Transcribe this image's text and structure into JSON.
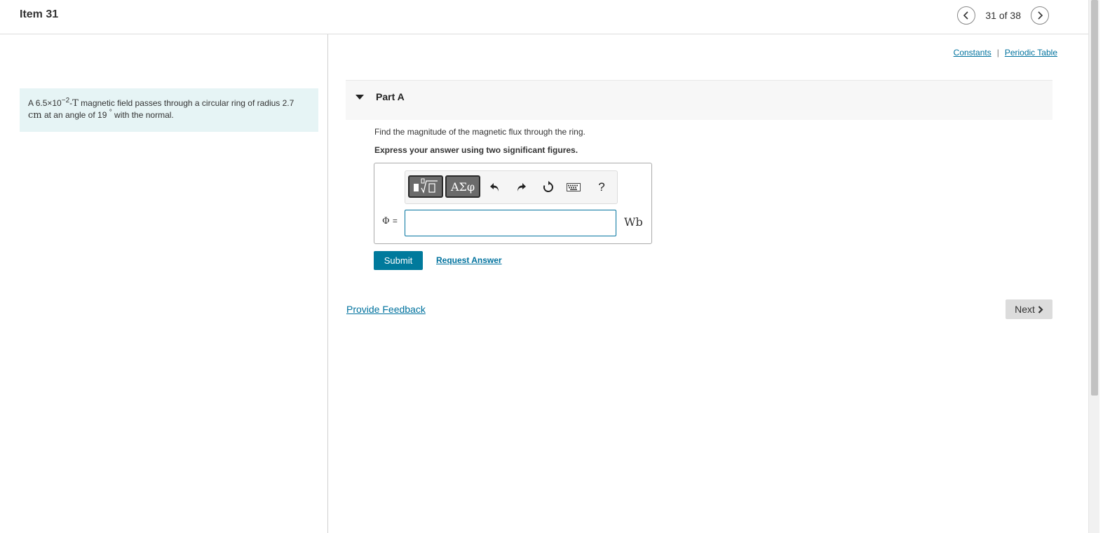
{
  "header": {
    "item_title": "Item 31",
    "counter": "31 of 38"
  },
  "links": {
    "constants": "Constants",
    "separator": "|",
    "periodic_table": "Periodic Table"
  },
  "problem": {
    "text_a": "A ",
    "field_value": "6.5×10",
    "field_exp": "−2",
    "field_unit": "T",
    "text_b": " magnetic field passes through a circular ring of radius ",
    "radius_value": "2.7",
    "radius_unit": "cm",
    "text_c": " at an angle of ",
    "angle_value": "19",
    "angle_unit": "°",
    "text_d": " with the normal."
  },
  "part": {
    "title": "Part A",
    "question": "Find the magnitude of the magnetic flux through the ring.",
    "instruction": "Express your answer using two significant figures."
  },
  "toolbar": {
    "greek_label": "ΑΣφ",
    "help_label": "?",
    "icons": [
      "templates-icon",
      "greek-symbols-icon",
      "undo-icon",
      "redo-icon",
      "reset-icon",
      "keyboard-icon",
      "help-icon"
    ]
  },
  "answer": {
    "variable": "Φ",
    "equals": "=",
    "value": "",
    "unit": "Wb"
  },
  "actions": {
    "submit": "Submit",
    "request_answer": "Request Answer",
    "provide_feedback": "Provide Feedback",
    "next": "Next"
  },
  "colors": {
    "accent": "#007a9c",
    "link": "#00729e",
    "problem_bg": "#e6f4f5"
  }
}
